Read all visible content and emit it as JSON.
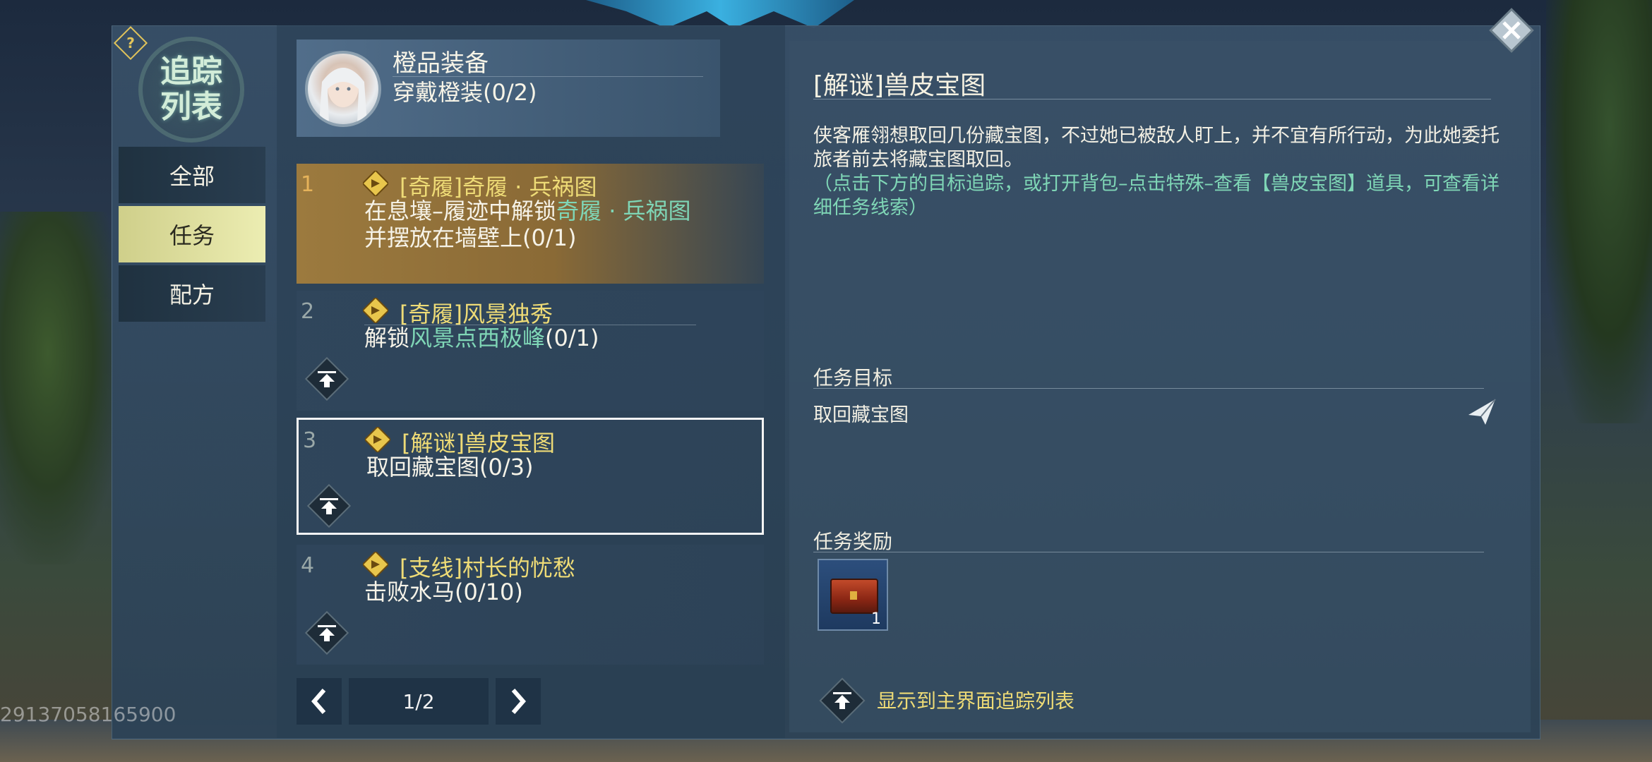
{
  "nav": {
    "title_line1": "追踪",
    "title_line2": "列表",
    "help_icon": "?",
    "tabs": [
      {
        "label": "全部",
        "active": false
      },
      {
        "label": "任务",
        "active": true
      },
      {
        "label": "配方",
        "active": false
      }
    ]
  },
  "header_card": {
    "title": "橙品装备",
    "subtitle": "穿戴橙装(0/2)"
  },
  "quests": [
    {
      "num": "1",
      "title": "[奇履]奇履 · 兵祸图",
      "desc_pre": "在息壤–履迹中解锁",
      "desc_link": "奇履 · 兵祸图",
      "desc_line2": "并摆放在墙壁上(0/1)"
    },
    {
      "num": "2",
      "title": "[奇履]风景独秀",
      "desc_pre": "解锁",
      "desc_link": "风景点西极峰",
      "desc_post": "(0/1)"
    },
    {
      "num": "3",
      "title": "[解谜]兽皮宝图",
      "desc": "取回藏宝图(0/3)"
    },
    {
      "num": "4",
      "title": "[支线]村长的忧愁",
      "desc": "击败水马(0/10)"
    }
  ],
  "pager": {
    "label": "1/2"
  },
  "footer_id": "29137058165900",
  "detail": {
    "title": "[解谜]兽皮宝图",
    "text": "侠客雁翎想取回几份藏宝图，不过她已被敌人盯上，并不宜有所行动，为此她委托旅者前去将藏宝图取回。",
    "hint": "（点击下方的目标追踪，或打开背包–点击特殊–查看【兽皮宝图】道具，可查看详细任务线索）",
    "goal_header": "任务目标",
    "goal_text": "取回藏宝图",
    "reward_header": "任务奖励",
    "reward_count": "1",
    "show_label": "显示到主界面追踪列表"
  },
  "colors": {
    "accent_gold": "#eedb76",
    "link_green": "#7fd6b6",
    "active_tab": "#e6e6a6"
  },
  "icons": [
    "help-icon",
    "quest-marker-icon",
    "pin-to-top-icon",
    "arrow-left-icon",
    "arrow-right-icon",
    "send-icon",
    "treasure-chest-icon",
    "close-icon"
  ]
}
